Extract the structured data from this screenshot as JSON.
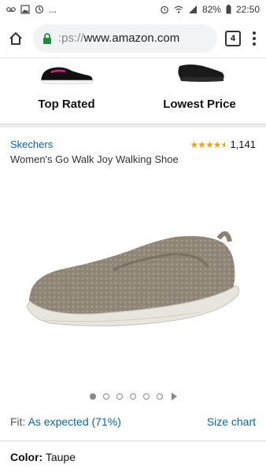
{
  "status_bar": {
    "dots": "...",
    "battery": "82%",
    "time": "22:50"
  },
  "browser": {
    "url_scheme": ":ps://",
    "url_host": "www.amazon.com",
    "tab_count": "4"
  },
  "compare": {
    "items": [
      {
        "label": "Top Rated"
      },
      {
        "label": "Lowest Price"
      }
    ]
  },
  "product": {
    "brand": "Skechers",
    "rating_count": "1,141",
    "rating_value": 4.5,
    "title": "Women's Go Walk Joy Walking Shoe",
    "image_count": 6,
    "active_image": 1
  },
  "fit": {
    "label": "Fit:",
    "value": "As expected (71%)",
    "size_chart": "Size chart"
  },
  "color": {
    "label": "Color:",
    "value": "Taupe"
  },
  "colors": {
    "link": "#0066c0",
    "star": "#f0a30a",
    "secure": "#1e8e3e"
  }
}
